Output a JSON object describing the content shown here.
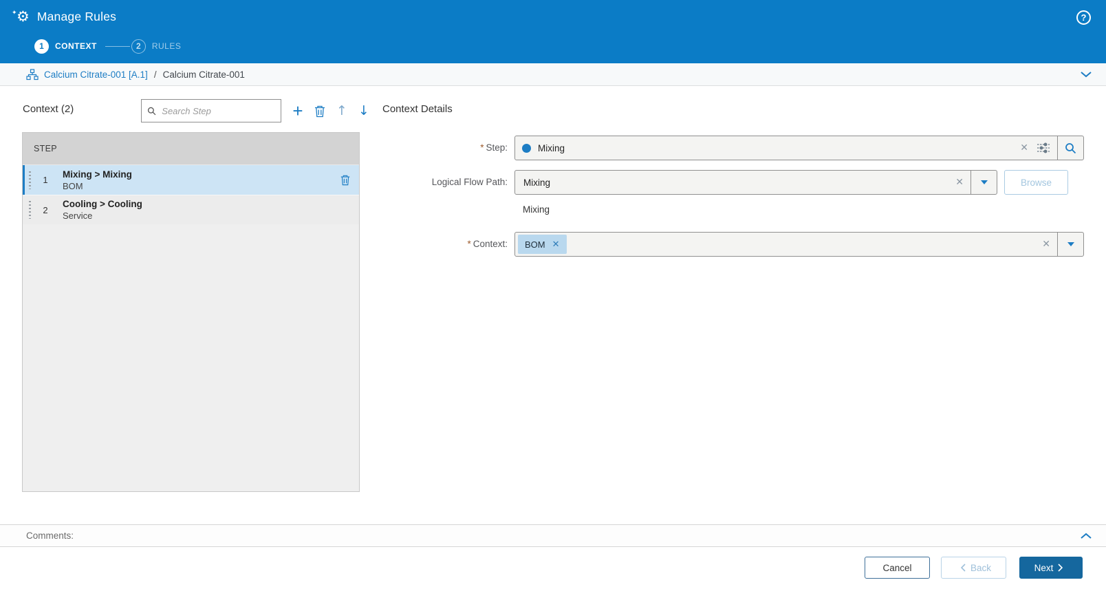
{
  "colors": {
    "header_blue": "#0b7cc6",
    "accent_blue": "#1d7dc4",
    "selected_row_bg": "#cde4f5",
    "primary_button_bg": "#15679e",
    "chip_bg": "#b9d8ee"
  },
  "icons": {
    "gear": "⚙",
    "sparkle": "✦",
    "help": "?",
    "plus": "+",
    "up_arrow": "↑",
    "down_arrow": "↓",
    "clear": "✕",
    "chip_remove": "✕"
  },
  "header": {
    "title": "Manage Rules",
    "steps": [
      {
        "number": "1",
        "label": "CONTEXT"
      },
      {
        "number": "2",
        "label": "RULES"
      }
    ]
  },
  "breadcrumb": {
    "link": "Calcium Citrate-001 [A.1]",
    "separator": "/",
    "current": "Calcium Citrate-001"
  },
  "context_list": {
    "title": "Context (2)",
    "search_placeholder": "Search Step",
    "column_header": "STEP",
    "rows": [
      {
        "index": "1",
        "title": "Mixing > Mixing",
        "subtitle": "BOM"
      },
      {
        "index": "2",
        "title": "Cooling > Cooling",
        "subtitle": "Service"
      }
    ]
  },
  "details": {
    "title": "Context Details",
    "step": {
      "required_marker": "*",
      "label": "Step:",
      "value": "Mixing"
    },
    "logical_flow_path": {
      "label": "Logical Flow Path:",
      "value": "Mixing",
      "browse_label": "Browse",
      "selected_path": "Mixing"
    },
    "context": {
      "required_marker": "*",
      "label": "Context:",
      "chip": "BOM"
    }
  },
  "comments": {
    "label": "Comments:"
  },
  "footer": {
    "cancel_label": "Cancel",
    "back_label": "Back",
    "next_label": "Next"
  }
}
